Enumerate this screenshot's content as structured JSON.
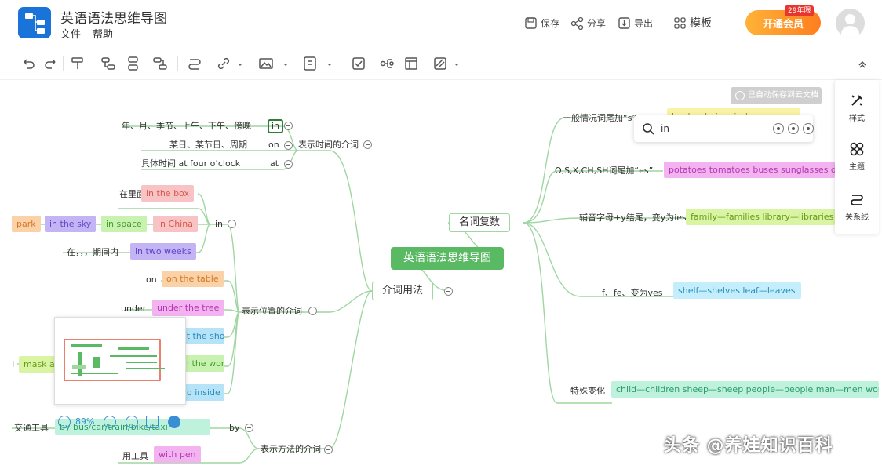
{
  "header": {
    "title": "英语语法思维导图",
    "menu": {
      "file": "文件",
      "help": "帮助"
    },
    "save": "保存",
    "share": "分享",
    "export": "导出",
    "template": "模板",
    "vip_badge": "开通会员",
    "vip_tag": "29年限"
  },
  "toolbar": {
    "icons": [
      "undo-icon",
      "redo-icon",
      "format-painter-icon",
      "child-node-icon",
      "sibling-node-icon",
      "parent-node-icon",
      "relation-line-icon",
      "link-icon",
      "image-icon",
      "note-icon",
      "task-icon",
      "summary-icon",
      "frame-icon",
      "fill-icon",
      "collapse-panel-icon"
    ]
  },
  "canvas": {
    "root": "英语语法思维导图",
    "search_placeholder": "in",
    "tip_badge": "已自动保存到云文档",
    "right_panel": {
      "style": "样式",
      "theme": "主题",
      "relation": "关系线"
    },
    "nouns": {
      "label": "名词复数",
      "rules": [
        {
          "label": "一般情况词尾加“s”",
          "example": "books  chairs  airplanes"
        },
        {
          "label": "O,S,X,CH,SH词尾加“es”",
          "example": "potatoes tomatoes buses sunglasses d"
        },
        {
          "label": "辅音字母+y结尾，变y为ies",
          "example": "family—families  library—libraries  c"
        },
        {
          "label": "f、fe、变为ves",
          "example": "shelf—shelves  leaf—leaves"
        },
        {
          "label": "特殊变化",
          "example": "child—children  sheep—sheep  people—people  man—men  woma"
        }
      ]
    },
    "preps": {
      "label": "介词用法",
      "time": {
        "label": "表示时间的介词",
        "items": [
          {
            "label": "年、月、季节、上午、下午、傍晚",
            "prep": "in"
          },
          {
            "label": "某日、某节日、周期",
            "prep": "on"
          },
          {
            "label": "具体时间 at four o’clock",
            "prep": "at"
          }
        ]
      },
      "place": {
        "label": "表示位置的介词",
        "in_label": "in",
        "in_items": [
          "在里面",
          "in the box",
          "park",
          "in the sky",
          "in space",
          "in China",
          "在，，，期间内",
          "in two weeks"
        ],
        "on_label": "on",
        "on_example": "on the table",
        "under_label": "under",
        "under_example": "under the tree",
        "at_example": "at the shop",
        "world_example": "in the world",
        "inside_example": "go inside",
        "mask_example": "mask and",
        "left_label": "I"
      },
      "method": {
        "label": "表示方法的介词",
        "by_label": "by",
        "transport_label": "交通工具",
        "transport_example": "by bus/car/train/bike/taxi",
        "tool_label": "用工具",
        "tool_example": "with pen"
      }
    },
    "zoom": "89%",
    "watermark": "头条 @养娃知识百科"
  },
  "colors": {
    "accent": "#5ab963",
    "primary": "#1a73d9",
    "vip": "#ff8a1e"
  }
}
